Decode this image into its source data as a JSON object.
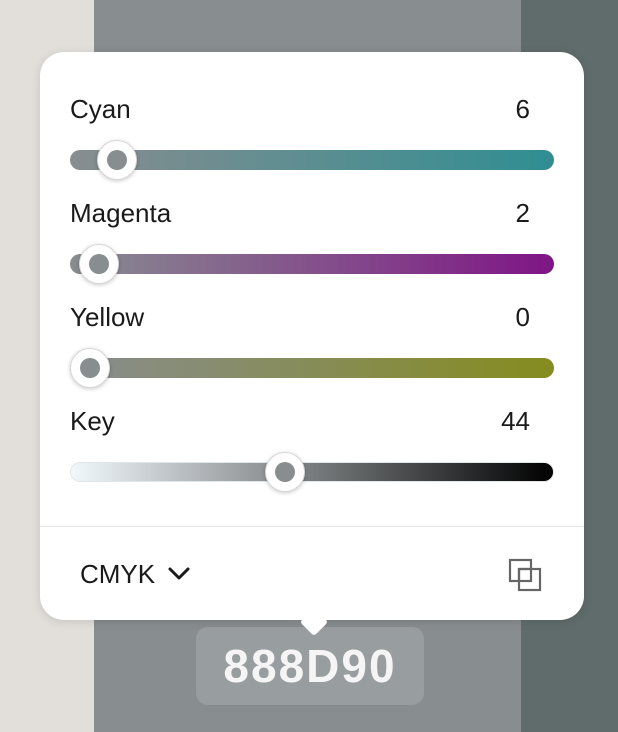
{
  "picker": {
    "channels": [
      {
        "id": "cyan",
        "label": "Cyan",
        "value": "6",
        "max": 100,
        "gradient_start": "#888d90",
        "gradient_end": "#2f8e92"
      },
      {
        "id": "magenta",
        "label": "Magenta",
        "value": "2",
        "max": 100,
        "gradient_start": "#888d90",
        "gradient_end": "#7f1586"
      },
      {
        "id": "yellow",
        "label": "Yellow",
        "value": "0",
        "max": 100,
        "gradient_start": "#888d90",
        "gradient_end": "#858c1e"
      },
      {
        "id": "key",
        "label": "Key",
        "value": "44",
        "max": 100,
        "gradient_start": "#f1f8fc",
        "gradient_end": "#000000"
      }
    ],
    "mode": "CMYK",
    "copy_icon": "copy-icon",
    "chevron_icon": "chevron-down-icon"
  },
  "hex_value": "888D90",
  "colors": {
    "current": "#888d90",
    "background_left": "#e2dfda",
    "background_right": "#606c6b"
  }
}
